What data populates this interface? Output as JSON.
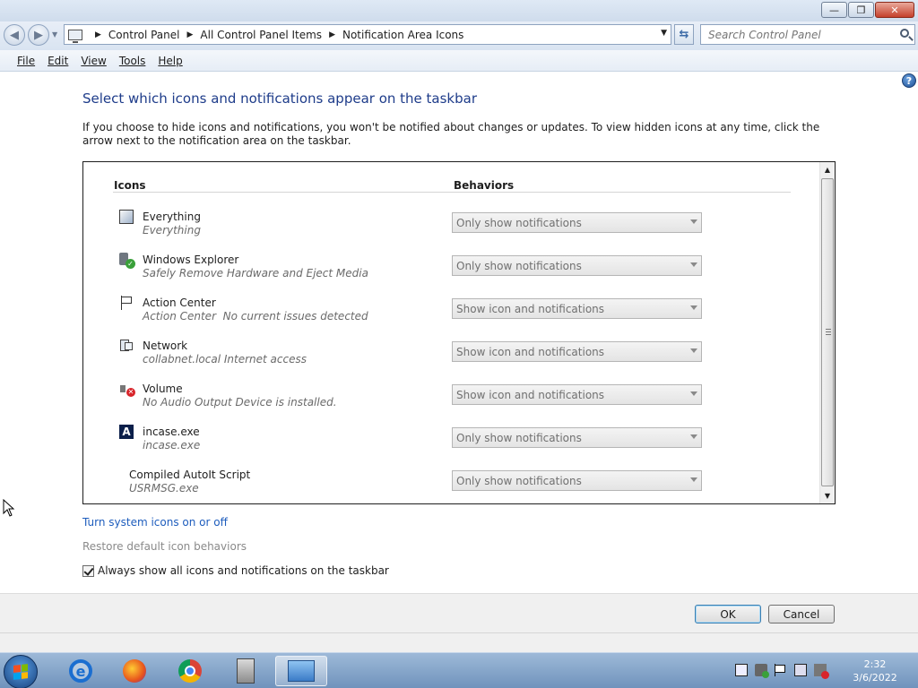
{
  "window": {
    "minimize_glyph": "—",
    "restore_glyph": "❐",
    "close_glyph": "✕"
  },
  "address": {
    "breadcrumbs": [
      "Control Panel",
      "All Control Panel Items",
      "Notification Area Icons"
    ],
    "search_placeholder": "Search Control Panel"
  },
  "menu": {
    "items": [
      "File",
      "Edit",
      "View",
      "Tools",
      "Help"
    ]
  },
  "page": {
    "heading": "Select which icons and notifications appear on the taskbar",
    "description": "If you choose to hide icons and notifications, you won't be notified about changes or updates. To view hidden icons at any time, click the arrow next to the notification area on the taskbar.",
    "col_icons": "Icons",
    "col_behaviors": "Behaviors",
    "rows": [
      {
        "name": "Everything",
        "sub": "Everything",
        "behavior": "Only show notifications",
        "icon": "everything-icon"
      },
      {
        "name": "Windows Explorer",
        "sub": "Safely Remove Hardware and Eject Media",
        "behavior": "Only show notifications",
        "icon": "usb-check-icon"
      },
      {
        "name": "Action Center",
        "sub": "Action Center  No current issues detected",
        "behavior": "Show icon and notifications",
        "icon": "flag-icon"
      },
      {
        "name": "Network",
        "sub": "collabnet.local Internet access",
        "behavior": "Show icon and notifications",
        "icon": "network-icon"
      },
      {
        "name": "Volume",
        "sub": "No Audio Output Device is installed.",
        "behavior": "Show icon and notifications",
        "icon": "volume-muted-icon"
      },
      {
        "name": "incase.exe",
        "sub": "incase.exe",
        "behavior": "Only show notifications",
        "icon": "incase-icon"
      },
      {
        "name": "Compiled AutoIt Script",
        "sub": "USRMSG.exe",
        "behavior": "Only show notifications",
        "icon": ""
      }
    ],
    "link_system_icons": "Turn system icons on or off",
    "link_restore": "Restore default icon behaviors",
    "always_show_label": "Always show all icons and notifications on the taskbar",
    "always_show_checked": true,
    "ok_label": "OK",
    "cancel_label": "Cancel"
  },
  "taskbar": {
    "time": "2:32",
    "date": "3/6/2022"
  },
  "colors": {
    "heading": "#1e3c8a",
    "link": "#1e5dbd",
    "taskbar": "#7d9fc6"
  }
}
